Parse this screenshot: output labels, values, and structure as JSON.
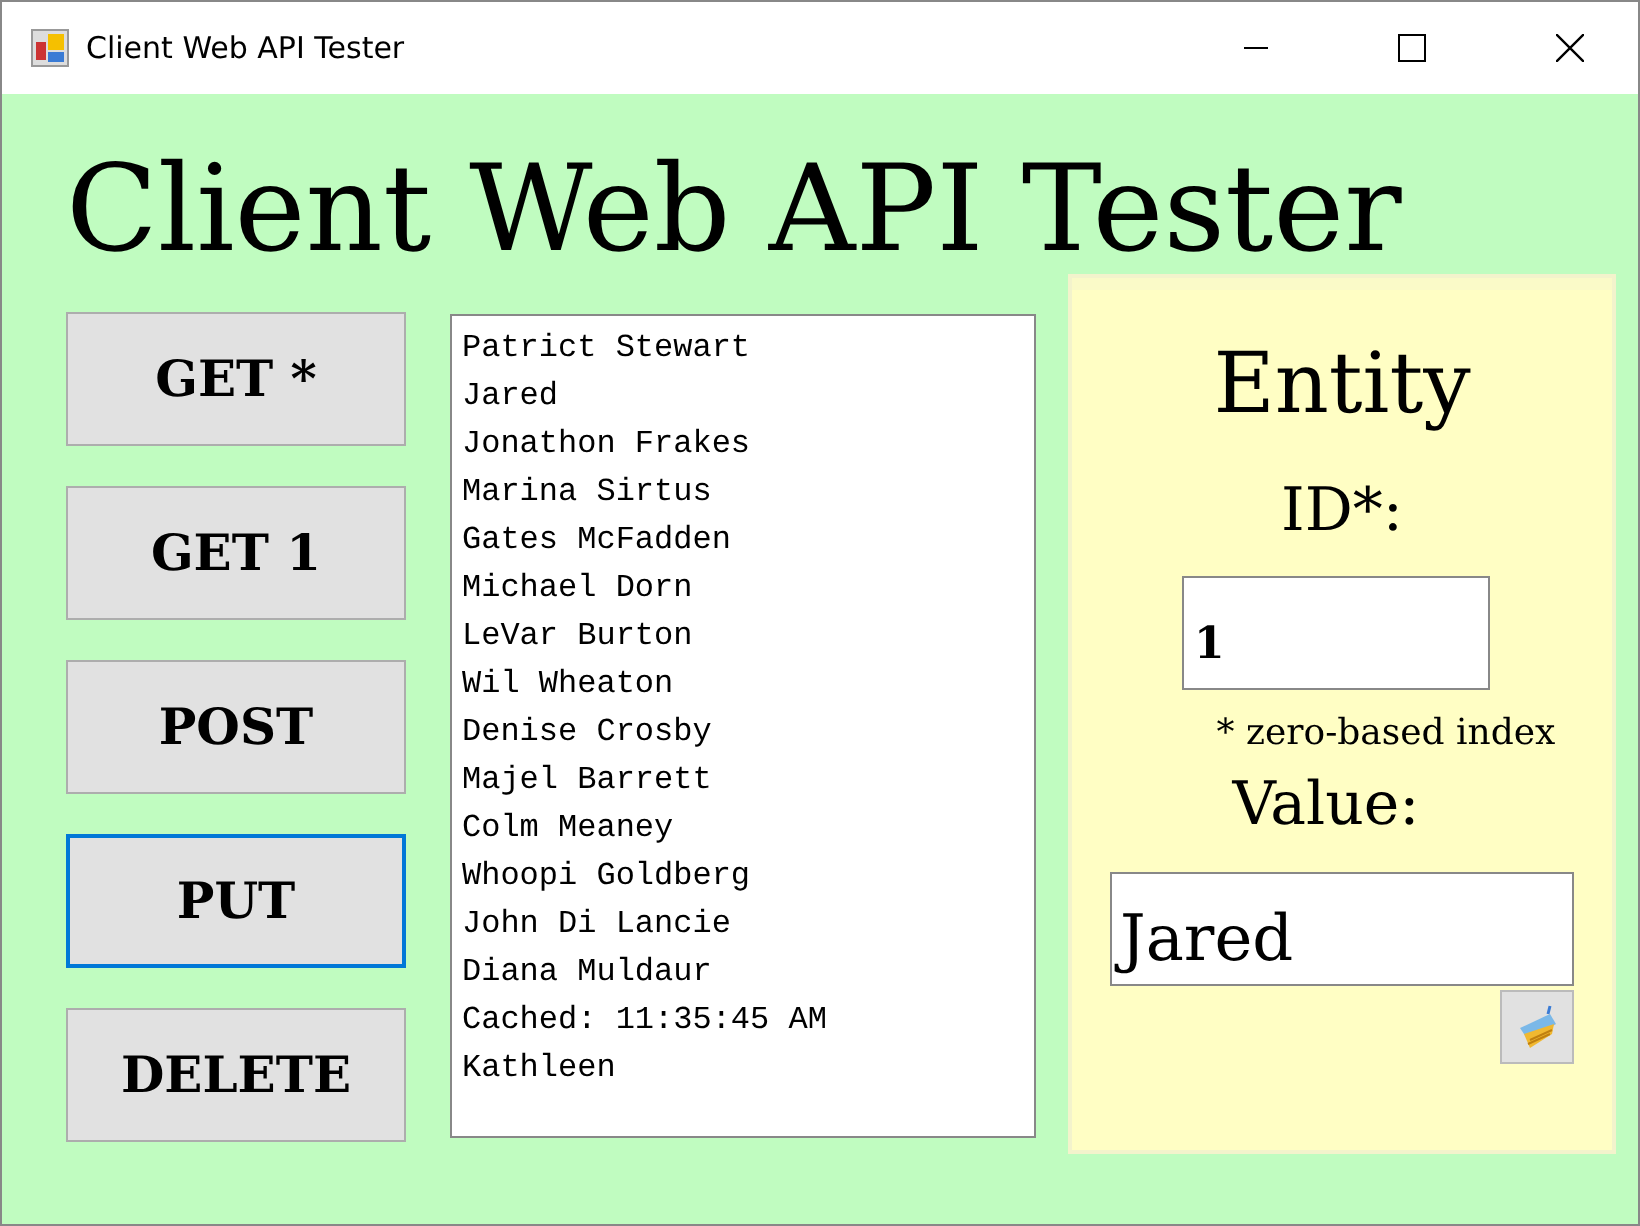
{
  "window": {
    "title": "Client Web API Tester"
  },
  "heading": "Client Web API Tester",
  "buttons": [
    {
      "label": "GET *",
      "focused": false
    },
    {
      "label": "GET 1",
      "focused": false
    },
    {
      "label": "POST",
      "focused": false
    },
    {
      "label": "PUT",
      "focused": true
    },
    {
      "label": "DELETE",
      "focused": false
    }
  ],
  "list": {
    "items": [
      "Patrict Stewart",
      "Jared",
      "Jonathon Frakes",
      "Marina Sirtus",
      "Gates McFadden",
      "Michael Dorn",
      "LeVar Burton",
      "Wil Wheaton",
      "Denise Crosby",
      "Majel Barrett",
      "Colm Meaney",
      "Whoopi Goldberg",
      "John Di Lancie",
      "Diana Muldaur",
      "Cached: 11:35:45 AM",
      "Kathleen"
    ]
  },
  "entity": {
    "title": "Entity",
    "id_label": "ID*:",
    "id_value": "1",
    "note": "* zero-based index",
    "value_label": "Value:",
    "value": "Jared"
  }
}
